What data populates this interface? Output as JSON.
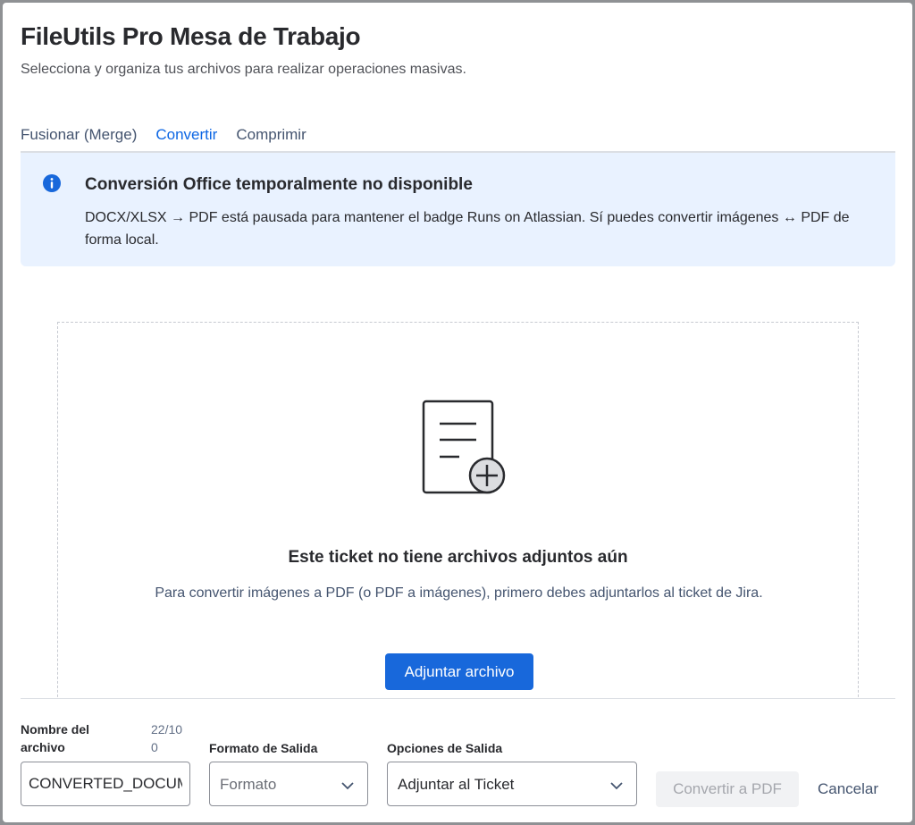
{
  "header": {
    "title": "FileUtils Pro Mesa de Trabajo",
    "subtitle": "Selecciona y organiza tus archivos para realizar operaciones masivas."
  },
  "tabs": [
    {
      "label": "Fusionar (Merge)",
      "active": false
    },
    {
      "label": "Convertir",
      "active": true
    },
    {
      "label": "Comprimir",
      "active": false
    }
  ],
  "info_banner": {
    "icon": "info-icon",
    "title": "Conversión Office temporalmente no disponible",
    "body": "DOCX/XLSX → PDF está pausada para mantener el badge Runs on Atlassian. Sí puedes convertir imágenes ↔ PDF de forma local."
  },
  "empty_state": {
    "icon": "document-add-icon",
    "title": "Este ticket no tiene archivos adjuntos aún",
    "body": "Para convertir imágenes a PDF (o PDF a imágenes), primero debes adjuntarlos al ticket de Jira.",
    "button_label": "Adjuntar archivo"
  },
  "footer": {
    "filename_label": "Nombre del archivo",
    "filename_counter": "22/100",
    "filename_value": "CONVERTED_DOCUMENT",
    "format_label": "Formato de Salida",
    "format_placeholder": "Formato",
    "options_label": "Opciones de Salida",
    "options_value": "Adjuntar al Ticket",
    "convert_label": "Convertir a PDF",
    "cancel_label": "Cancelar"
  },
  "colors": {
    "accent": "#0c66e4",
    "primary_button": "#1868db",
    "info_background": "#e9f2ff",
    "info_icon": "#1868db"
  }
}
